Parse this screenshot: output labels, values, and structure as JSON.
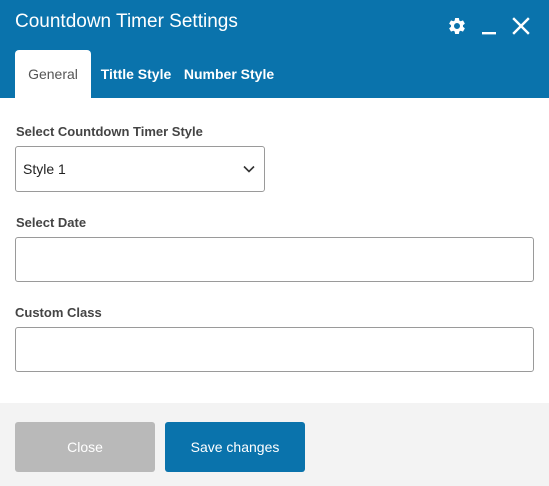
{
  "header": {
    "title": "Countdown Timer Settings",
    "icons": [
      "gear-icon",
      "minimize-icon",
      "close-icon"
    ]
  },
  "tabs": [
    {
      "label": "General",
      "active": true
    },
    {
      "label": "Tittle Style",
      "active": false
    },
    {
      "label": "Number Style",
      "active": false
    }
  ],
  "form": {
    "style_label": "Select Countdown Timer Style",
    "style_value": "Style 1",
    "date_label": "Select Date",
    "date_value": "",
    "class_label": "Custom Class",
    "class_value": ""
  },
  "footer": {
    "close_label": "Close",
    "save_label": "Save changes"
  },
  "colors": {
    "accent": "#0a73ac",
    "close_button": "#b9b9b9",
    "footer_bg": "#f3f3f3"
  }
}
